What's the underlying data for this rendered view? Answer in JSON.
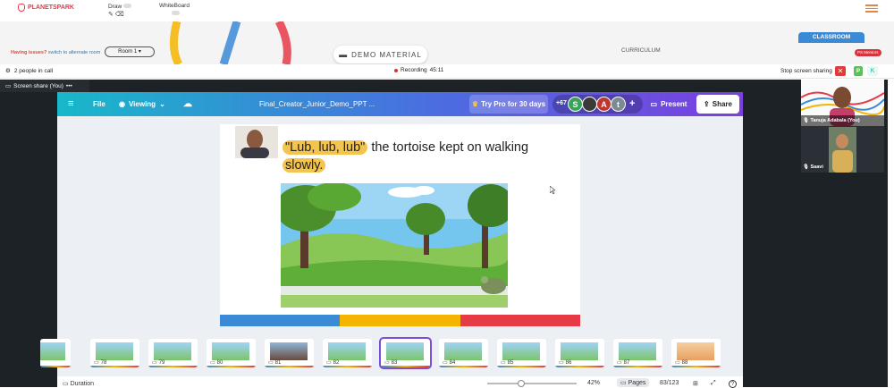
{
  "topbar": {
    "logo": "PLANETSPARK",
    "draw_label": "Draw",
    "whiteboard_label": "WhiteBoard"
  },
  "band": {
    "issues_text": "Having issues?",
    "switch_text": "switch to alternate room",
    "room_select": "Room 1",
    "demo_material": "DEMO MATERIAL",
    "curriculum": "CURRICULUM",
    "classroom_tab": "CLASSROOM",
    "mentors_badge": "PS Mentors"
  },
  "callbar": {
    "people": "2 people in call",
    "recording_label": "Recording",
    "recording_time": "45:11",
    "stop_sharing": "Stop screen sharing",
    "p_button": "P",
    "x_button": "✕",
    "k_button": "K"
  },
  "screenshare": {
    "label": "Screen share (You)",
    "more": "•••"
  },
  "canva": {
    "menu": "≡",
    "file": "File",
    "viewing": "Viewing",
    "doc_title": "Final_Creator_Junior_Demo_PPT ...",
    "try_pro": "Try Pro for 30 days",
    "collab_count": "+67",
    "avatars": [
      {
        "letter": "S",
        "color": "#3aa35a"
      },
      {
        "letter": "",
        "color": "#3a3a3a"
      },
      {
        "letter": "A",
        "color": "#c0362c"
      },
      {
        "letter": "t",
        "color": "#7c8a94"
      }
    ],
    "plus": "+",
    "present": "Present",
    "share": "Share"
  },
  "slide": {
    "highlight1": "\"Lub, lub, lub\"",
    "text1": " the tortoise kept on walking",
    "highlight2": "slowly.",
    "strip_colors": [
      "#3b8ad6",
      "#f4b400",
      "#e63a46"
    ]
  },
  "thumbnails": [
    {
      "num": ""
    },
    {
      "num": "78"
    },
    {
      "num": "79"
    },
    {
      "num": "80"
    },
    {
      "num": "81"
    },
    {
      "num": "82"
    },
    {
      "num": "83",
      "selected": true
    },
    {
      "num": "84"
    },
    {
      "num": "85"
    },
    {
      "num": "86"
    },
    {
      "num": "87"
    },
    {
      "num": "88"
    }
  ],
  "footer": {
    "duration": "Duration",
    "zoom": "42%",
    "pages": "Pages",
    "page_count": "83/123",
    "help": "?"
  },
  "participants": [
    {
      "name": "Tanuja Adabala (You)"
    },
    {
      "name": "Saavi"
    }
  ]
}
